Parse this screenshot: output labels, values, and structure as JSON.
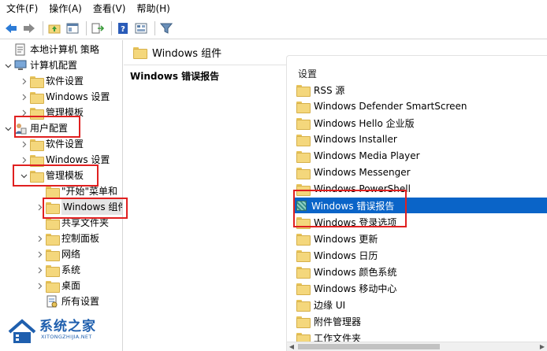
{
  "menu": [
    {
      "label": "文件(F)"
    },
    {
      "label": "操作(A)"
    },
    {
      "label": "查看(V)"
    },
    {
      "label": "帮助(H)"
    }
  ],
  "tree": [
    {
      "label": "本地计算机 策略",
      "level": 0,
      "exp": "",
      "icon": "policy"
    },
    {
      "label": "计算机配置",
      "level": 0,
      "exp": "down",
      "icon": "computer"
    },
    {
      "label": "软件设置",
      "level": 1,
      "exp": "right",
      "icon": "folder"
    },
    {
      "label": "Windows 设置",
      "level": 1,
      "exp": "right",
      "icon": "folder"
    },
    {
      "label": "管理模板",
      "level": 1,
      "exp": "right",
      "icon": "folder"
    },
    {
      "label": "用户配置",
      "level": 0,
      "exp": "down",
      "icon": "user"
    },
    {
      "label": "软件设置",
      "level": 1,
      "exp": "right",
      "icon": "folder"
    },
    {
      "label": "Windows 设置",
      "level": 1,
      "exp": "right",
      "icon": "folder"
    },
    {
      "label": "管理模板",
      "level": 1,
      "exp": "down",
      "icon": "folder"
    },
    {
      "label": "\"开始\"菜单和",
      "level": 2,
      "exp": "",
      "icon": "folder"
    },
    {
      "label": "Windows 组件",
      "level": 2,
      "exp": "right",
      "icon": "folder",
      "selected": true
    },
    {
      "label": "共享文件夹",
      "level": 2,
      "exp": "",
      "icon": "folder"
    },
    {
      "label": "控制面板",
      "level": 2,
      "exp": "right",
      "icon": "folder"
    },
    {
      "label": "网络",
      "level": 2,
      "exp": "right",
      "icon": "folder"
    },
    {
      "label": "系统",
      "level": 2,
      "exp": "right",
      "icon": "folder"
    },
    {
      "label": "桌面",
      "level": 2,
      "exp": "right",
      "icon": "folder"
    },
    {
      "label": "所有设置",
      "level": 2,
      "exp": "",
      "icon": "settings"
    }
  ],
  "path": {
    "label": "Windows 组件"
  },
  "description": {
    "title": "Windows 错误报告"
  },
  "list": {
    "header": "设置",
    "items": [
      {
        "label": "RSS 源",
        "icon": "folder"
      },
      {
        "label": "Windows Defender SmartScreen",
        "icon": "folder"
      },
      {
        "label": "Windows Hello 企业版",
        "icon": "folder"
      },
      {
        "label": "Windows Installer",
        "icon": "folder"
      },
      {
        "label": "Windows Media Player",
        "icon": "folder"
      },
      {
        "label": "Windows Messenger",
        "icon": "folder"
      },
      {
        "label": "Windows PowerShell",
        "icon": "folder"
      },
      {
        "label": "Windows 错误报告",
        "icon": "setting",
        "selected": true
      },
      {
        "label": "Windows 登录选项",
        "icon": "folder"
      },
      {
        "label": "Windows 更新",
        "icon": "folder"
      },
      {
        "label": "Windows 日历",
        "icon": "folder"
      },
      {
        "label": "Windows 颜色系统",
        "icon": "folder"
      },
      {
        "label": "Windows 移动中心",
        "icon": "folder"
      },
      {
        "label": "边缘 UI",
        "icon": "folder"
      },
      {
        "label": "附件管理器",
        "icon": "folder"
      },
      {
        "label": "工作文件夹",
        "icon": "folder"
      }
    ]
  },
  "watermark": {
    "name": "系统之家",
    "url": "XITONGZHIJIA.NET"
  },
  "colors": {
    "selection": "#0a64c8",
    "highlight": "#e02020",
    "folder": "#f4d77c"
  }
}
